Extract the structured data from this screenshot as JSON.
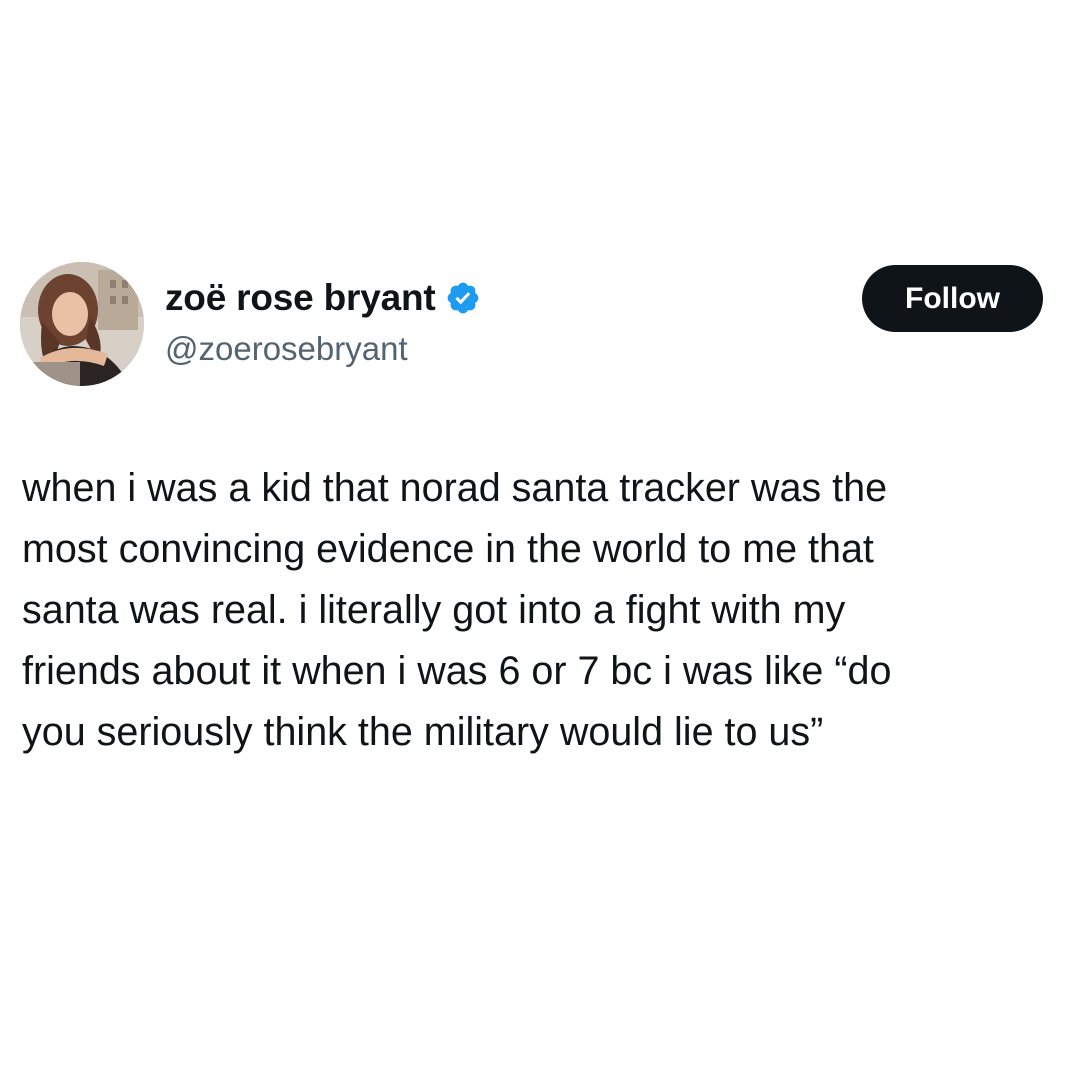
{
  "author": {
    "display_name": "zoë rose bryant",
    "handle": "@zoerosebryant",
    "verified": true,
    "verified_color": "#1d9bf0",
    "avatar_icon": "profile-photo"
  },
  "actions": {
    "follow_label": "Follow"
  },
  "tweet": {
    "lines": [
      "when i was a kid that norad santa tracker was the",
      "most convincing evidence in the world to me that",
      "santa was real. i literally got into a fight with my",
      "friends about it when i was 6 or 7 bc i was like “do",
      "you seriously think the military would lie to us”"
    ]
  },
  "colors": {
    "background": "#ffffff",
    "text": "#0f1419",
    "secondary_text": "#536471",
    "button_bg": "#0f1419",
    "button_text": "#ffffff"
  }
}
